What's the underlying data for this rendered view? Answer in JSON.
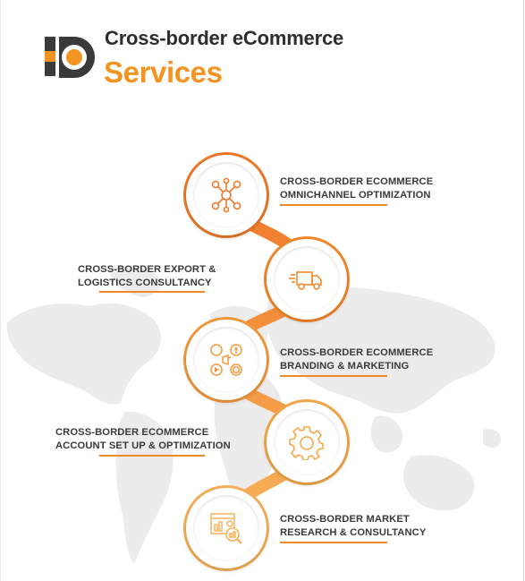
{
  "header": {
    "title_line1": "Cross-border eCommerce",
    "title_line2": "Services"
  },
  "colors": {
    "accent": "#f39322",
    "accent_dark": "#e86f1e",
    "text": "#2e2e2e",
    "logo_dark": "#3a3a3a"
  },
  "services": [
    {
      "line1": "CROSS-BORDER ECOMMERCE",
      "line2": "OMNICHANNEL OPTIMIZATION",
      "icon": "network-nodes-icon"
    },
    {
      "line1": "CROSS-BORDER EXPORT &",
      "line2": "LOGISTICS CONSULTANCY",
      "icon": "delivery-truck-icon"
    },
    {
      "line1": "CROSS-BORDER ECOMMERCE",
      "line2": "BRANDING & MARKETING",
      "icon": "social-media-icon"
    },
    {
      "line1": "CROSS-BORDER ECOMMERCE",
      "line2": "ACCOUNT SET UP & OPTIMIZATION",
      "icon": "gear-icon"
    },
    {
      "line1": "CROSS-BORDER MARKET",
      "line2": "RESEARCH & CONSULTANCY",
      "icon": "market-research-icon"
    }
  ]
}
